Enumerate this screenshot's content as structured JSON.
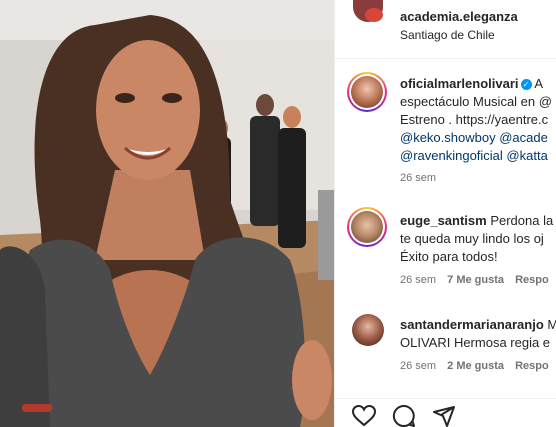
{
  "post": {
    "media_alt": "",
    "header": {
      "username": "academia.eleganza",
      "location": "Santiago de Chile"
    }
  },
  "caption": {
    "username": "oficialmarlenolivari",
    "verified": true,
    "lines": [
      "A",
      "espectáculo Musical en @",
      "Estreno . https://yaentre.c",
      "@keko.showboy @acade",
      "@ravenkingoficial @katta"
    ],
    "time": "26 sem"
  },
  "comments": [
    {
      "username": "euge_santism",
      "lines": [
        "Perdona la",
        "te queda muy lindo los oj",
        "Éxito para todos!"
      ],
      "time": "26 sem",
      "likes": "7 Me gusta",
      "reply": "Respo"
    },
    {
      "username": "santandermarianaranjo",
      "lines": [
        "M",
        "OLIVARI Hermosa regia e"
      ],
      "time": "26 sem",
      "likes": "2 Me gusta",
      "reply": "Respo"
    }
  ],
  "actions": {
    "like_icon": "heart-icon",
    "comment_icon": "comment-icon",
    "share_icon": "share-icon"
  },
  "colors": {
    "link": "#00376b",
    "verified": "#0095f6",
    "text": "#262626",
    "meta": "#737373"
  }
}
